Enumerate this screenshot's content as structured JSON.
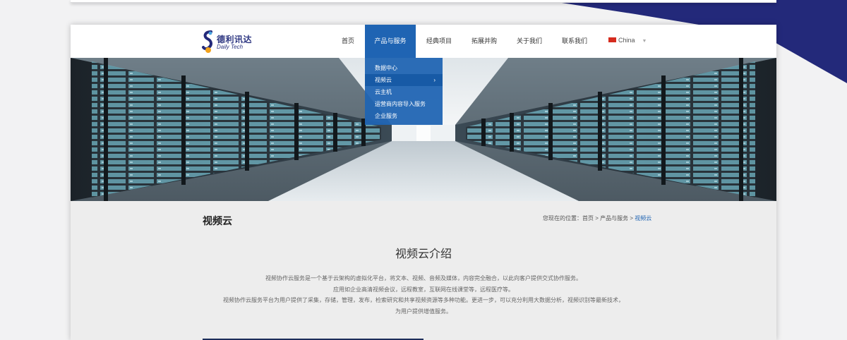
{
  "colors": {
    "brand_blue": "#1f64b3",
    "navy": "#23297a",
    "page_bg": "#ededed"
  },
  "logo": {
    "cn": "德利讯达",
    "en": "Daily Tech",
    "icon": "s-swirl-logo-icon"
  },
  "nav": {
    "items": [
      {
        "label": "首页"
      },
      {
        "label": "产品与服务",
        "active": true
      },
      {
        "label": "经典项目"
      },
      {
        "label": "拓展并购"
      },
      {
        "label": "关于我们"
      },
      {
        "label": "联系我们"
      }
    ],
    "lang": {
      "label": "China",
      "flag_icon": "china-flag-icon",
      "caret_icon": "chevron-down-icon"
    }
  },
  "dropdown": {
    "items": [
      {
        "label": "数据中心"
      },
      {
        "label": "视频云",
        "selected": true,
        "arrow": "›"
      },
      {
        "label": "云主机"
      },
      {
        "label": "运营商内容导入服务"
      },
      {
        "label": "企业服务"
      }
    ]
  },
  "content": {
    "page_title": "视频云",
    "breadcrumb": {
      "prefix": "您现在的位置：",
      "home": "首页",
      "sep": ">",
      "parent": "产品与服务",
      "current": "视频云"
    },
    "section_title": "视频云介绍",
    "paragraphs": [
      "视频协作云服务是一个基于云架构的虚拟化平台，将文本、视频、音频及媒体，内容完全融合，以此向客户提供交式协作服务。",
      "应用如企业高清视频会议，远程教室，互联网在线课堂等，远程医疗等。",
      "视频协作云服务平台为用户提供了采集，存储，管理，发布，检索研究和共享视频资源等多种功能。更进一步，可以充分利用大数据分析，视频识别等最新技术，",
      "为用户提供增值服务。"
    ]
  }
}
